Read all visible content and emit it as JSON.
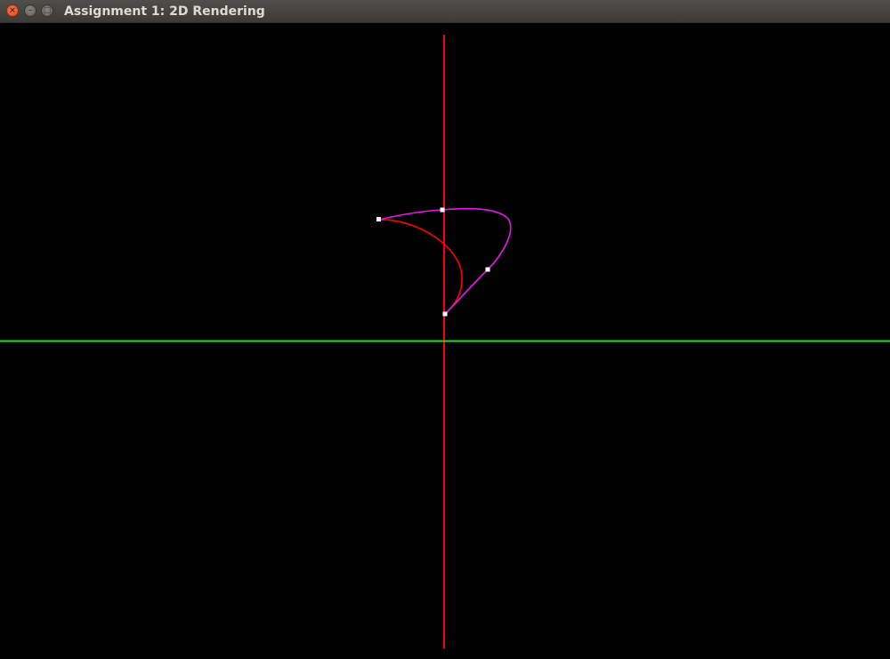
{
  "window": {
    "title": "Assignment 1: 2D Rendering",
    "buttons": {
      "close_glyph": "×",
      "minimize_glyph": "–",
      "maximize_glyph": "□"
    }
  },
  "scene": {
    "background_color": "#000000",
    "vertical_axis_color": "#ff0000",
    "horizontal_axis_color": "#00ff00",
    "curve_magenta_color": "#ff00ff",
    "curve_red_color": "#ff0000",
    "control_point_color": "#ffffff",
    "control_point_count": 4
  }
}
